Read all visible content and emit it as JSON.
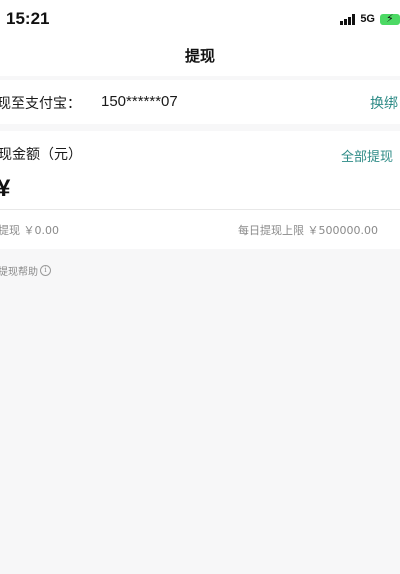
{
  "status_bar": {
    "time": "15:21",
    "network": "5G",
    "icons": [
      "signal-icon",
      "battery-charging-icon"
    ]
  },
  "header": {
    "title": "提现"
  },
  "account": {
    "label": "现至支付宝：",
    "number": "150******07",
    "change_label": "换绑"
  },
  "amount": {
    "label": "现金额（元）",
    "withdraw_all_label": "全部提现",
    "currency_symbol": "¥",
    "input_value": "",
    "available_text": "提现 ￥0.00",
    "limit_text": "每日提现上限 ￥500000.00"
  },
  "help": {
    "label": "提现帮助",
    "icon": "info-icon"
  },
  "colors": {
    "accent": "#2d8b86",
    "background": "#f7f7f8",
    "card": "#ffffff",
    "muted_text": "#8a8a8a",
    "battery": "#4cd964"
  }
}
